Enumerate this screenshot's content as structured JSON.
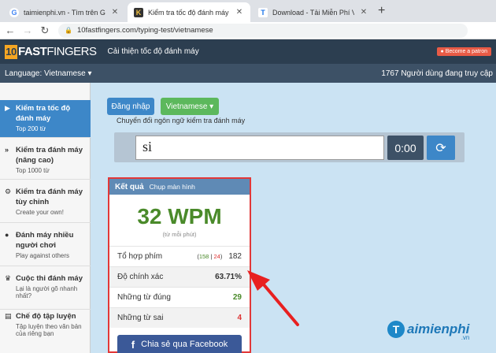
{
  "browser": {
    "tabs": [
      {
        "label": "taimienphi.vn - Tìm trên Google",
        "favicon": "google-icon"
      },
      {
        "label": "Kiểm tra tốc độ đánh máy Vietna",
        "favicon": "10fastfingers-icon"
      },
      {
        "label": "Download - Tải Miễn Phí VN - Ph",
        "favicon": "taimienphi-icon"
      }
    ],
    "active_tab": 1,
    "url": "10fastfingers.com/typing-test/vietnamese"
  },
  "header": {
    "logo_box": "10",
    "logo_fast": "FAST",
    "logo_fingers": "FINGERS",
    "tagline": "Cải thiện tốc độ đánh máy",
    "patron": "Become a patron",
    "language": "Language: Vietnamese",
    "online": "1767 Người dùng đang truy cập"
  },
  "sidebar": {
    "items": [
      {
        "title": "Kiểm tra tốc độ đánh máy",
        "sub": "Top 200 từ",
        "icon": "keyboard-icon"
      },
      {
        "title": "Kiểm tra đánh máy (nâng cao)",
        "sub": "Top 1000 từ",
        "icon": "forward-icon"
      },
      {
        "title": "Kiểm tra đánh máy tùy chỉnh",
        "sub": "Create your own!",
        "icon": "gears-icon"
      },
      {
        "title": "Đánh máy nhiều người chơi",
        "sub": "Play against others",
        "icon": "users-icon"
      },
      {
        "title": "Cuộc thi đánh máy",
        "sub": "Lại là người gõ nhanh nhất?",
        "icon": "trophy-icon"
      },
      {
        "title": "Chế độ tập luyện",
        "sub": "Tập luyện theo văn bản của riêng bạn",
        "icon": "book-icon"
      }
    ]
  },
  "main": {
    "login_label": "Đăng nhập",
    "language_select": "Vietnamese",
    "switch_note": "Chuyển đổi ngôn ngữ kiểm tra đánh máy",
    "typed_text": "si",
    "timer": "0:00"
  },
  "result": {
    "title": "Kết quả",
    "screenshot_link": "Chụp màn hình",
    "wpm": "32 WPM",
    "wpm_sub": "(từ mỗi phút)",
    "keystrokes_label": "Tổ hợp phím",
    "keystrokes_open": "(",
    "keystrokes_correct": "158",
    "keystrokes_sep": "|",
    "keystrokes_wrong": "24",
    "keystrokes_close": ")",
    "keystrokes_total": "182",
    "accuracy_label": "Độ chính xác",
    "accuracy_value": "63.71%",
    "correct_label": "Những từ đúng",
    "correct_value": "29",
    "wrong_label": "Những từ sai",
    "wrong_value": "4",
    "facebook_label": "Chia sẻ qua Facebook"
  },
  "watermark": {
    "brand": "aimienphi",
    "initial": "T",
    "suffix": ".vn"
  },
  "colors": {
    "header_dark": "#2c3e50",
    "accent_blue": "#3d87c8",
    "wpm_green": "#4a8a2a",
    "highlight_red": "#e23838"
  }
}
